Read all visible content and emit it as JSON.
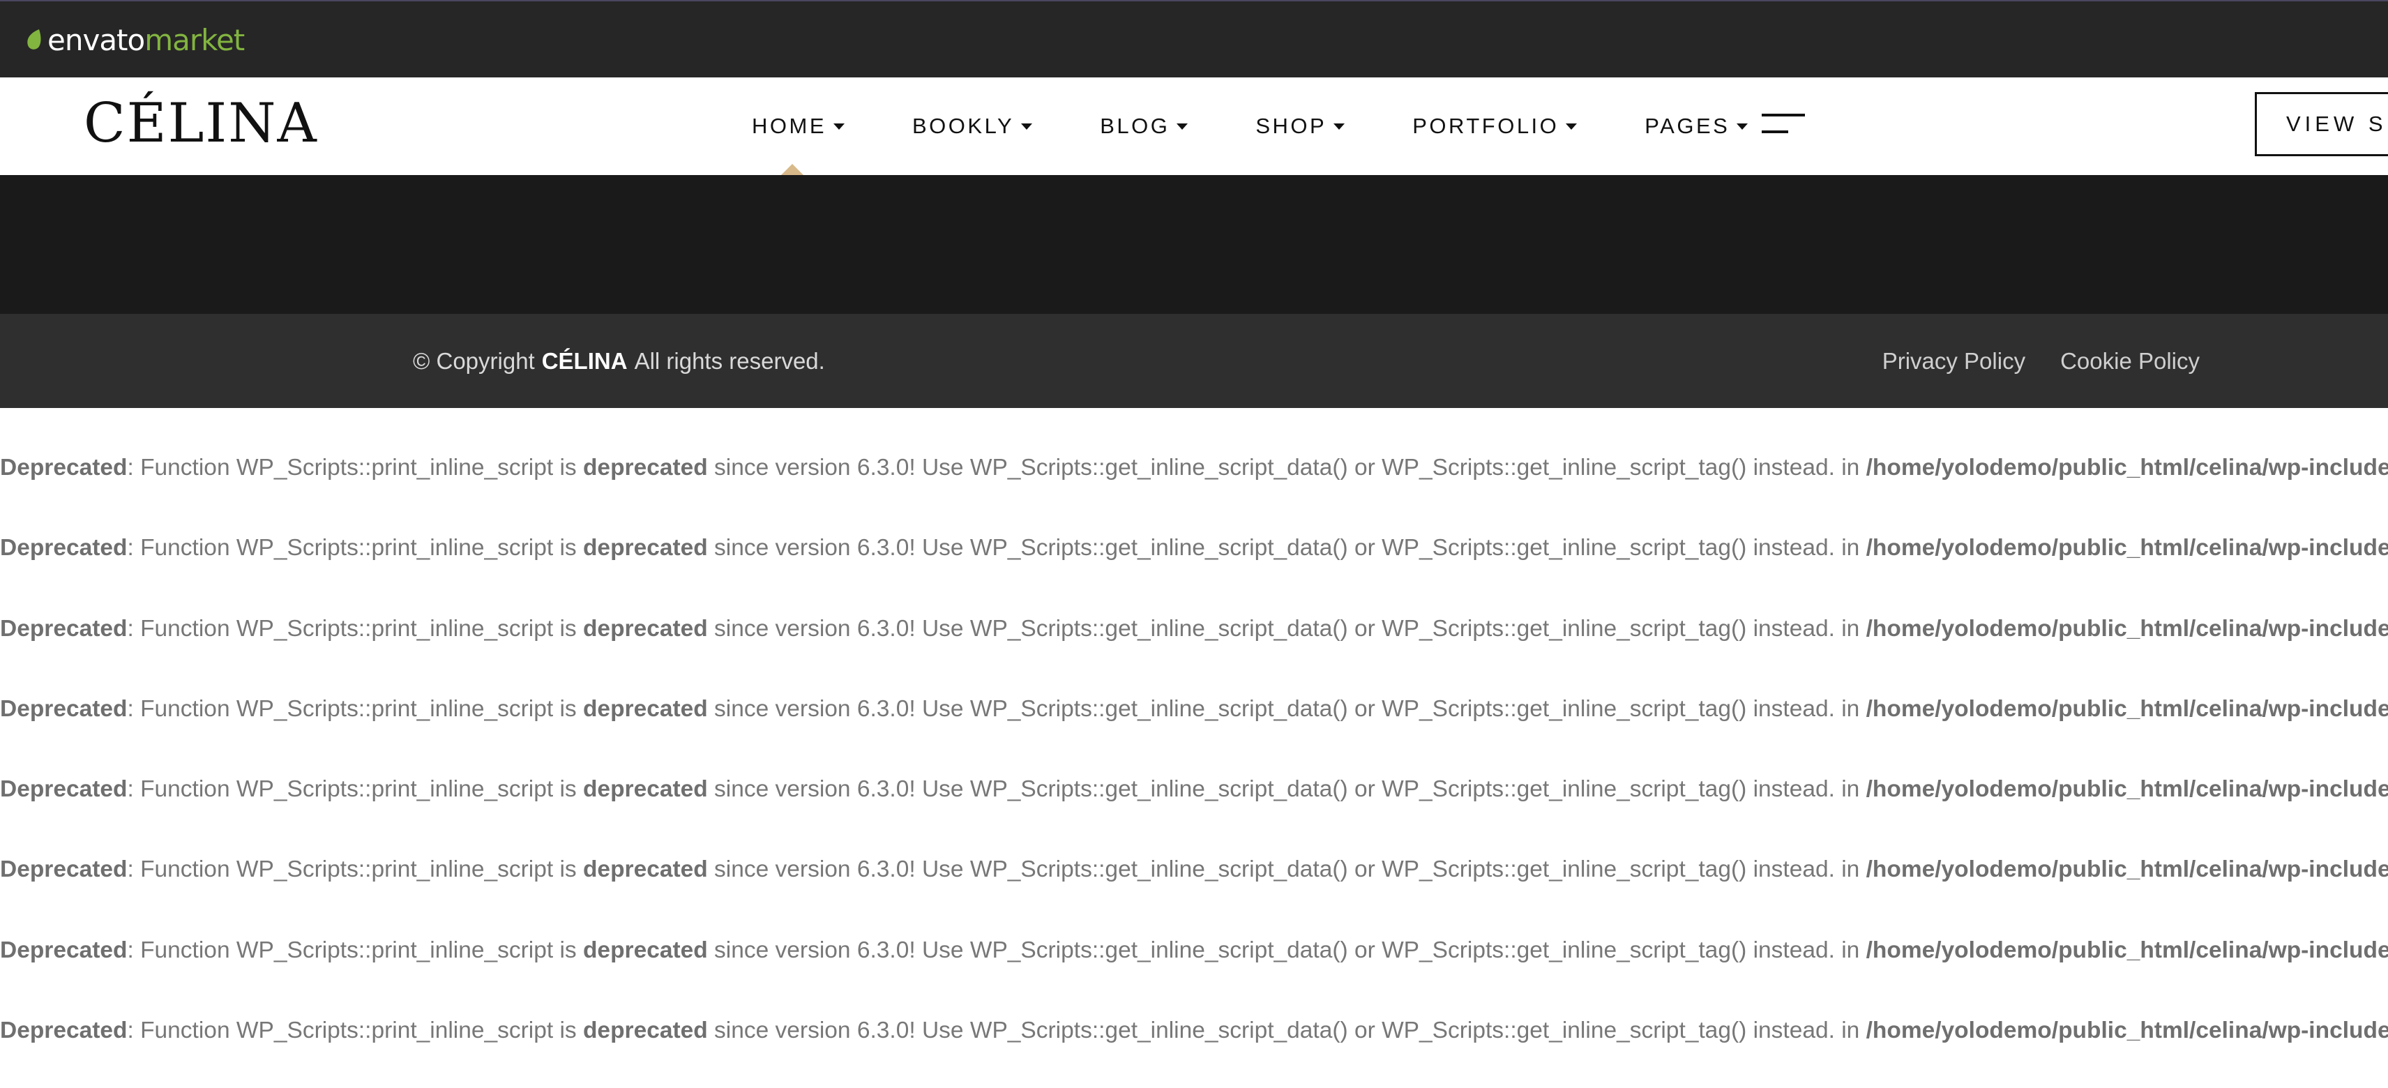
{
  "envato": {
    "word1": "envato",
    "word2": "market",
    "accent": "#82b440"
  },
  "header": {
    "logo": "CÉLINA",
    "nav": [
      {
        "label": "HOME",
        "active": true
      },
      {
        "label": "BOOKLY"
      },
      {
        "label": "BLOG"
      },
      {
        "label": "SHOP"
      },
      {
        "label": "PORTFOLIO"
      },
      {
        "label": "PAGES"
      }
    ],
    "menu_icon": "menu-lines-icon",
    "view_button": "VIEW SO",
    "active_marker_color": "#d8b98a"
  },
  "footer": {
    "copyright_prefix": "© Copyright",
    "copyright_brand": "CÉLINA",
    "copyright_suffix": "All rights reserved.",
    "links": [
      "Privacy Policy",
      "Cookie Policy"
    ]
  },
  "notices": {
    "label": "Deprecated",
    "text1": ": Function WP_Scripts::print_inline_script is ",
    "keyword": "deprecated",
    "text2": " since version 6.3.0! Use WP_Scripts::get_inline_script_data() or WP_Scripts::get_inline_script_tag() instead. in ",
    "path": "/home/yolodemo/public_html/celina/wp-includes/functions.php",
    "count": 8
  }
}
